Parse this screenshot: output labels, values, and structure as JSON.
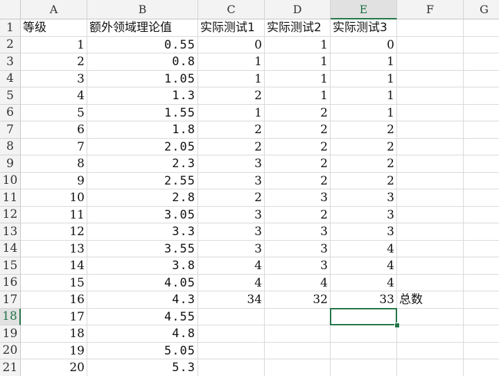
{
  "columns": [
    "A",
    "B",
    "C",
    "D",
    "E",
    "F",
    "G"
  ],
  "selected_column": "E",
  "selected_row": 18,
  "accent_color": "#217346",
  "rows": [
    {
      "num": "1",
      "a": "等级",
      "b": "额外领域理论值",
      "c": "实际测试1",
      "d": "实际测试2",
      "e": "实际测试3",
      "f": ""
    },
    {
      "num": "2",
      "a": "1",
      "b": "0.55",
      "c": "0",
      "d": "1",
      "e": "0",
      "f": ""
    },
    {
      "num": "3",
      "a": "2",
      "b": "0.8",
      "c": "1",
      "d": "1",
      "e": "1",
      "f": ""
    },
    {
      "num": "4",
      "a": "3",
      "b": "1.05",
      "c": "1",
      "d": "1",
      "e": "1",
      "f": ""
    },
    {
      "num": "5",
      "a": "4",
      "b": "1.3",
      "c": "2",
      "d": "1",
      "e": "1",
      "f": ""
    },
    {
      "num": "6",
      "a": "5",
      "b": "1.55",
      "c": "1",
      "d": "2",
      "e": "1",
      "f": ""
    },
    {
      "num": "7",
      "a": "6",
      "b": "1.8",
      "c": "2",
      "d": "2",
      "e": "2",
      "f": ""
    },
    {
      "num": "8",
      "a": "7",
      "b": "2.05",
      "c": "2",
      "d": "2",
      "e": "2",
      "f": ""
    },
    {
      "num": "9",
      "a": "8",
      "b": "2.3",
      "c": "3",
      "d": "2",
      "e": "2",
      "f": ""
    },
    {
      "num": "10",
      "a": "9",
      "b": "2.55",
      "c": "3",
      "d": "2",
      "e": "2",
      "f": ""
    },
    {
      "num": "11",
      "a": "10",
      "b": "2.8",
      "c": "2",
      "d": "3",
      "e": "3",
      "f": ""
    },
    {
      "num": "12",
      "a": "11",
      "b": "3.05",
      "c": "3",
      "d": "2",
      "e": "3",
      "f": ""
    },
    {
      "num": "13",
      "a": "12",
      "b": "3.3",
      "c": "3",
      "d": "3",
      "e": "3",
      "f": ""
    },
    {
      "num": "14",
      "a": "13",
      "b": "3.55",
      "c": "3",
      "d": "3",
      "e": "4",
      "f": ""
    },
    {
      "num": "15",
      "a": "14",
      "b": "3.8",
      "c": "4",
      "d": "3",
      "e": "4",
      "f": ""
    },
    {
      "num": "16",
      "a": "15",
      "b": "4.05",
      "c": "4",
      "d": "4",
      "e": "4",
      "f": ""
    },
    {
      "num": "17",
      "a": "16",
      "b": "4.3",
      "c": "34",
      "d": "32",
      "e": "33",
      "f": "总数"
    },
    {
      "num": "18",
      "a": "17",
      "b": "4.55",
      "c": "",
      "d": "",
      "e": "",
      "f": ""
    },
    {
      "num": "19",
      "a": "18",
      "b": "4.8",
      "c": "",
      "d": "",
      "e": "",
      "f": ""
    },
    {
      "num": "20",
      "a": "19",
      "b": "5.05",
      "c": "",
      "d": "",
      "e": "",
      "f": ""
    },
    {
      "num": "21",
      "a": "20",
      "b": "5.3",
      "c": "",
      "d": "",
      "e": "",
      "f": ""
    }
  ]
}
